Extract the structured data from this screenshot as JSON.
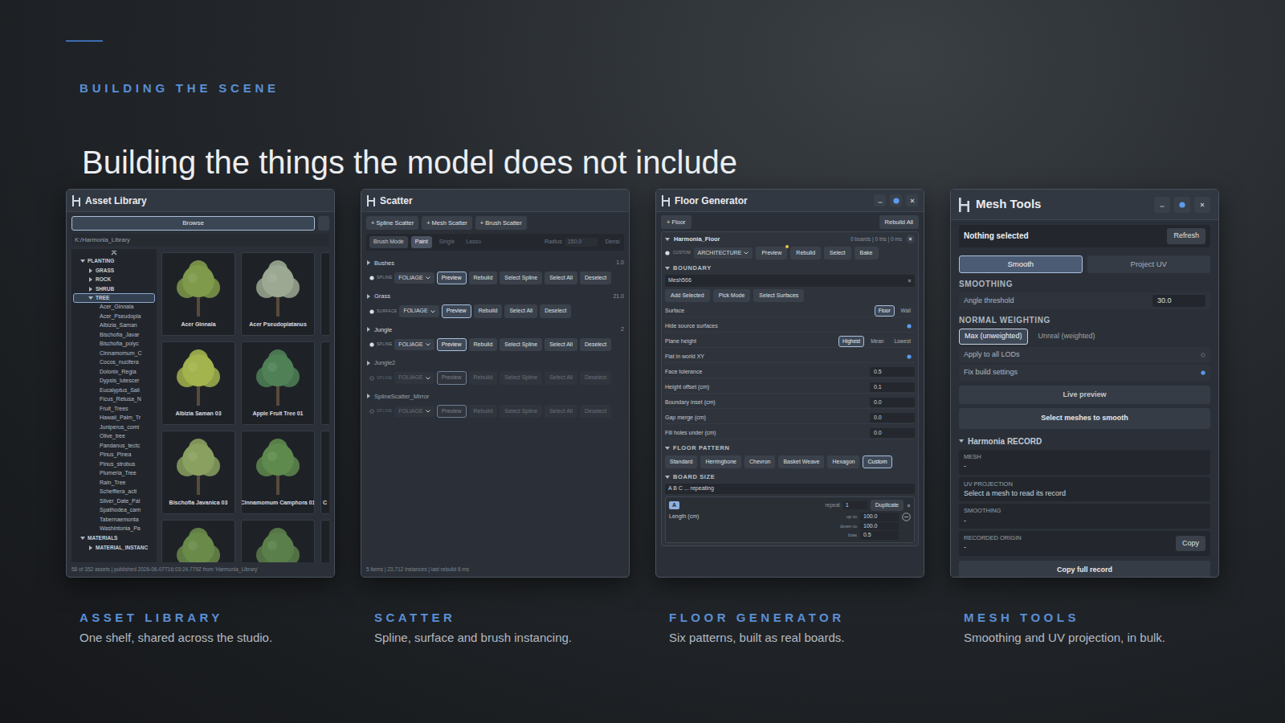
{
  "slide": {
    "eyebrow": "BUILDING THE SCENE",
    "title": "Building the things the model does not include"
  },
  "asset_library": {
    "title": "Asset Library",
    "browse": "Browse",
    "path": "K:/Harmonia_Library",
    "tree": [
      {
        "label": "PLANTING",
        "kind": "folder",
        "depth": 0,
        "expanded": true,
        "selected": false
      },
      {
        "label": "GRASS",
        "kind": "folder",
        "depth": 1,
        "expanded": false,
        "selected": false
      },
      {
        "label": "ROCK",
        "kind": "folder",
        "depth": 1,
        "expanded": false,
        "selected": false
      },
      {
        "label": "SHRUB",
        "kind": "folder",
        "depth": 1,
        "expanded": false,
        "selected": false
      },
      {
        "label": "TREE",
        "kind": "folder",
        "depth": 1,
        "expanded": true,
        "selected": true
      },
      {
        "label": "Acer_Ginnala",
        "kind": "leaf",
        "depth": 2,
        "selected": false
      },
      {
        "label": "Acer_Pseudopla",
        "kind": "leaf",
        "depth": 2,
        "selected": false
      },
      {
        "label": "Albizia_Saman",
        "kind": "leaf",
        "depth": 2,
        "selected": false
      },
      {
        "label": "Bischofia_Javar",
        "kind": "leaf",
        "depth": 2,
        "selected": false
      },
      {
        "label": "Bischofia_polyc",
        "kind": "leaf",
        "depth": 2,
        "selected": false
      },
      {
        "label": "Cinnamomum_C",
        "kind": "leaf",
        "depth": 2,
        "selected": false
      },
      {
        "label": "Cocos_nucifera",
        "kind": "leaf",
        "depth": 2,
        "selected": false
      },
      {
        "label": "Dolonix_Regia",
        "kind": "leaf",
        "depth": 2,
        "selected": false
      },
      {
        "label": "Dypsis_lutescer",
        "kind": "leaf",
        "depth": 2,
        "selected": false
      },
      {
        "label": "Eucalyptus_Sali",
        "kind": "leaf",
        "depth": 2,
        "selected": false
      },
      {
        "label": "Ficus_Retusa_N",
        "kind": "leaf",
        "depth": 2,
        "selected": false
      },
      {
        "label": "Fruit_Trees",
        "kind": "leaf",
        "depth": 2,
        "selected": false
      },
      {
        "label": "Hawaii_Palm_Tr",
        "kind": "leaf",
        "depth": 2,
        "selected": false
      },
      {
        "label": "Juniperus_comi",
        "kind": "leaf",
        "depth": 2,
        "selected": false
      },
      {
        "label": "Olive_tree",
        "kind": "leaf",
        "depth": 2,
        "selected": false
      },
      {
        "label": "Pandanus_tectc",
        "kind": "leaf",
        "depth": 2,
        "selected": false
      },
      {
        "label": "Pinus_Pinea",
        "kind": "leaf",
        "depth": 2,
        "selected": false
      },
      {
        "label": "Pinus_strobus",
        "kind": "leaf",
        "depth": 2,
        "selected": false
      },
      {
        "label": "Plumeria_Tree",
        "kind": "leaf",
        "depth": 2,
        "selected": false
      },
      {
        "label": "Rain_Tree",
        "kind": "leaf",
        "depth": 2,
        "selected": false
      },
      {
        "label": "Schefflera_acti",
        "kind": "leaf",
        "depth": 2,
        "selected": false
      },
      {
        "label": "Silver_Date_Pal",
        "kind": "leaf",
        "depth": 2,
        "selected": false
      },
      {
        "label": "Spathodea_cam",
        "kind": "leaf",
        "depth": 2,
        "selected": false
      },
      {
        "label": "Tabernaemonta",
        "kind": "leaf",
        "depth": 2,
        "selected": false
      },
      {
        "label": "Washintonia_Pa",
        "kind": "leaf",
        "depth": 2,
        "selected": false
      },
      {
        "label": "MATERIALS",
        "kind": "folder",
        "depth": 0,
        "expanded": true,
        "selected": false
      },
      {
        "label": "MATERIAL_INSTANC",
        "kind": "folder",
        "depth": 1,
        "expanded": false,
        "selected": false
      }
    ],
    "thumbnails": [
      {
        "label": "Acer Ginnala"
      },
      {
        "label": "Acer Pseudoplatanus"
      },
      {
        "label": ""
      },
      {
        "label": "Albizia Saman 03"
      },
      {
        "label": "Apple Fruit Tree 01"
      },
      {
        "label": ""
      },
      {
        "label": "Bischofia Javanica 03"
      },
      {
        "label": "Cinnamomum Camphora 01"
      },
      {
        "label": "C"
      },
      {
        "label": ""
      },
      {
        "label": ""
      },
      {
        "label": ""
      }
    ],
    "footer": "58 of 352 assets | published 2026-06-07T16:03:24.779Z from 'Harmonia_Library'"
  },
  "scatter": {
    "title": "Scatter",
    "add_buttons": [
      "+ Spline Scatter",
      "+ Mesh Scatter",
      "+ Brush Scatter"
    ],
    "mode": {
      "label": "Brush Mode",
      "options": [
        {
          "label": "Paint",
          "selected": true,
          "disabled": false
        },
        {
          "label": "Single",
          "selected": false,
          "disabled": true
        },
        {
          "label": "Lasso",
          "selected": false,
          "disabled": true
        }
      ],
      "radius_label": "Radius",
      "radius": "150.0",
      "density_label": "Densi"
    },
    "groups": [
      {
        "name": "Bushes",
        "value": "1.0",
        "expanded": false,
        "enabled": true,
        "type": "SPLINE",
        "category": "FOLIAGE",
        "buttons": [
          {
            "label": "Preview",
            "selected": true
          },
          {
            "label": "Rebuild",
            "selected": false
          },
          {
            "label": "Select Spline",
            "selected": false
          },
          {
            "label": "Select All",
            "selected": false
          },
          {
            "label": "Deselect",
            "selected": false
          }
        ]
      },
      {
        "name": "Grass",
        "value": "21.0",
        "expanded": false,
        "enabled": true,
        "type": "SURFACE",
        "category": "FOLIAGE",
        "buttons": [
          {
            "label": "Preview",
            "selected": true
          },
          {
            "label": "Rebuild",
            "selected": false
          },
          {
            "label": "Select All",
            "selected": false
          },
          {
            "label": "Deselect",
            "selected": false
          }
        ]
      },
      {
        "name": "Jungle",
        "value": "2",
        "expanded": false,
        "enabled": true,
        "type": "SPLINE",
        "category": "FOLIAGE",
        "buttons": [
          {
            "label": "Preview",
            "selected": true
          },
          {
            "label": "Rebuild",
            "selected": false
          },
          {
            "label": "Select Spline",
            "selected": false
          },
          {
            "label": "Select All",
            "selected": false
          },
          {
            "label": "Deselect",
            "selected": false
          }
        ]
      },
      {
        "name": "Jungle2",
        "value": "",
        "expanded": false,
        "enabled": false,
        "type": "SPLINE",
        "category": "FOLIAGE",
        "buttons": [
          {
            "label": "Preview",
            "selected": true
          },
          {
            "label": "Rebuild",
            "selected": false
          },
          {
            "label": "Select Spline",
            "selected": false
          },
          {
            "label": "Select All",
            "selected": false
          },
          {
            "label": "Deselect",
            "selected": false
          }
        ]
      },
      {
        "name": "SplineScatter_Mirror",
        "value": "",
        "expanded": false,
        "enabled": false,
        "type": "SPLINE",
        "category": "FOLIAGE",
        "buttons": [
          {
            "label": "Preview",
            "selected": true
          },
          {
            "label": "Rebuild",
            "selected": false
          },
          {
            "label": "Select Spline",
            "selected": false
          },
          {
            "label": "Select All",
            "selected": false
          },
          {
            "label": "Deselect",
            "selected": false
          }
        ]
      }
    ],
    "footer": "5 items | 23,712 instances | last rebuild 6 ms"
  },
  "floor_generator": {
    "title": "Floor Generator",
    "add": "+ Floor",
    "rebuild_all": "Rebuild All",
    "item": {
      "name": "Harmonia_Floor",
      "expanded": true,
      "stats": "0 boards | 0 tris | 0 ms",
      "enabled": true,
      "badge": "CUSTOM",
      "category": "ARCHITECTURE",
      "buttons": [
        {
          "label": "Preview",
          "dirty": true
        },
        {
          "label": "Rebuild",
          "dirty": false
        },
        {
          "label": "Select",
          "dirty": false
        },
        {
          "label": "Bake",
          "dirty": false
        }
      ]
    },
    "boundary": {
      "label": "BOUNDARY",
      "expanded": true,
      "mesh": "Mesh566",
      "buttons": [
        "Add Selected",
        "Pick Mode",
        "Select Surfaces"
      ],
      "rows": [
        {
          "kind": "choice",
          "label": "Surface",
          "options": [
            {
              "label": "Floor",
              "selected": true
            },
            {
              "label": "Wall",
              "selected": false
            }
          ]
        },
        {
          "kind": "toggle",
          "label": "Hide source surfaces",
          "on": true
        },
        {
          "kind": "choice",
          "label": "Plane height",
          "options": [
            {
              "label": "Highest",
              "selected": true
            },
            {
              "label": "Mean",
              "selected": false
            },
            {
              "label": "Lowest",
              "selected": false
            }
          ]
        },
        {
          "kind": "toggle",
          "label": "Flat in world XY",
          "on": true
        },
        {
          "kind": "number",
          "label": "Face tolerance",
          "value": "0.5"
        },
        {
          "kind": "number",
          "label": "Height offset (cm)",
          "value": "0.1"
        },
        {
          "kind": "number",
          "label": "Boundary inset (cm)",
          "value": "0.0"
        },
        {
          "kind": "number",
          "label": "Gap merge (cm)",
          "value": "0.0"
        },
        {
          "kind": "number",
          "label": "Fill holes under (cm)",
          "value": "0.0"
        }
      ]
    },
    "pattern": {
      "label": "FLOOR PATTERN",
      "expanded": true,
      "options": [
        {
          "label": "Standard",
          "selected": false
        },
        {
          "label": "Herringbone",
          "selected": false
        },
        {
          "label": "Chevron",
          "selected": false
        },
        {
          "label": "Basket Weave",
          "selected": false
        },
        {
          "label": "Hexagon",
          "selected": false
        },
        {
          "label": "Custom",
          "selected": true
        }
      ]
    },
    "board_size": {
      "label": "BOARD SIZE",
      "expanded": true,
      "sequence": "A B C ... repeating",
      "board": {
        "letter": "A",
        "repeat_label": "repeat",
        "repeat": "1",
        "duplicate": "Duplicate",
        "length_label": "Length (cm)",
        "fields": [
          {
            "label": "up to",
            "value": "100.0"
          },
          {
            "label": "down to",
            "value": "100.0"
          },
          {
            "label": "bias",
            "value": "0.5"
          }
        ]
      }
    }
  },
  "mesh_tools": {
    "title": "Mesh Tools",
    "selection": "Nothing selected",
    "refresh": "Refresh",
    "tabs": [
      {
        "label": "Smooth",
        "selected": true
      },
      {
        "label": "Project UV",
        "selected": false
      }
    ],
    "smoothing": {
      "heading": "SMOOTHING",
      "angle_label": "Angle threshold",
      "angle": "30.0"
    },
    "weighting": {
      "heading": "NORMAL WEIGHTING",
      "options": [
        {
          "label": "Max (unweighted)",
          "selected": true
        },
        {
          "label": "Unreal (weighted)",
          "selected": false
        }
      ],
      "toggles": [
        {
          "label": "Apply to all LODs",
          "on": false
        },
        {
          "label": "Fix build settings",
          "on": true
        }
      ]
    },
    "live_preview": "Live preview",
    "select_meshes": "Select meshes to smooth",
    "record": {
      "heading": "Harmonia RECORD",
      "expanded": true,
      "fields": [
        {
          "label": "MESH",
          "value": "-",
          "action": ""
        },
        {
          "label": "UV PROJECTION",
          "value": "Select a mesh to read its record",
          "action": ""
        },
        {
          "label": "SMOOTHING",
          "value": "-",
          "action": ""
        },
        {
          "label": "RECORDED ORIGIN",
          "value": "-",
          "action": "Copy"
        }
      ],
      "copy_all": "Copy full record"
    }
  },
  "captions": [
    {
      "label": "ASSET LIBRARY",
      "text": "One shelf, shared across the studio."
    },
    {
      "label": "SCATTER",
      "text": "Spline, surface and brush instancing."
    },
    {
      "label": "FLOOR GENERATOR",
      "text": "Six patterns, built as real boards."
    },
    {
      "label": "MESH TOOLS",
      "text": "Smoothing and UV projection, in bulk."
    }
  ]
}
